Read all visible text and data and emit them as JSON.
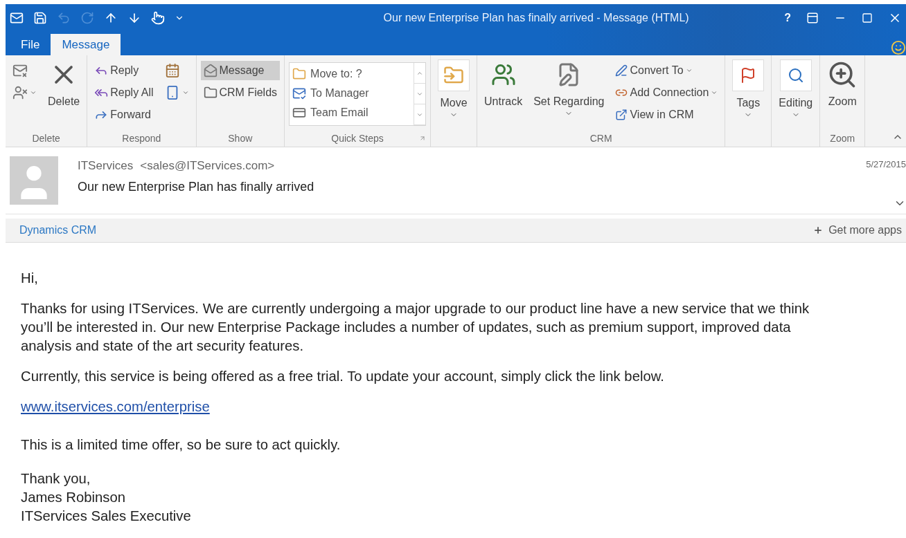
{
  "window": {
    "title": "Our new Enterprise Plan has finally arrived - Message (HTML)",
    "help": "?"
  },
  "quick_access": [
    {
      "disabled": false
    },
    {
      "disabled": false
    },
    {
      "disabled": true
    },
    {
      "disabled": true
    },
    {
      "disabled": false
    },
    {
      "disabled": false
    },
    {
      "disabled": false
    }
  ],
  "tabs": [
    {
      "label": "File",
      "selected": false
    },
    {
      "label": "Message",
      "selected": true
    }
  ],
  "ribbon": {
    "groups": [
      {
        "label": "Delete",
        "columns": [
          {
            "kind": "stack",
            "items": [
              {
                "dropdown": false
              },
              {
                "dropdown": true
              }
            ]
          },
          {
            "kind": "large",
            "items": [
              {
                "label": "Delete",
                "dropdown": false,
                "boxed": false
              }
            ]
          }
        ]
      },
      {
        "label": "Respond",
        "columns": [
          {
            "kind": "stack",
            "items": [
              {
                "label": "Reply",
                "dropdown": false,
                "selected": false
              },
              {
                "label": "Reply All",
                "dropdown": false,
                "selected": false
              },
              {
                "label": "Forward",
                "dropdown": false,
                "selected": false
              }
            ]
          },
          {
            "kind": "stack",
            "items": [
              {
                "dropdown": false
              },
              {
                "dropdown": true
              }
            ]
          }
        ]
      },
      {
        "label": "Show",
        "columns": [
          {
            "kind": "stack",
            "items": [
              {
                "label": "Message",
                "dropdown": false,
                "selected": true
              },
              {
                "label": "CRM Fields",
                "dropdown": false,
                "selected": false
              }
            ]
          }
        ]
      },
      {
        "label": "Quick Steps",
        "launcher": true,
        "columns": [
          {
            "kind": "gallery",
            "items": [
              {
                "label": "Move to: ?"
              },
              {
                "label": "To Manager"
              },
              {
                "label": "Team Email"
              }
            ]
          }
        ]
      },
      {
        "columns": [
          {
            "kind": "large",
            "items": [
              {
                "label": "Move",
                "dropdown": true,
                "boxed": true
              }
            ]
          }
        ]
      },
      {
        "label": "CRM",
        "columns": [
          {
            "kind": "large",
            "items": [
              {
                "label": "Untrack",
                "dropdown": false,
                "boxed": false
              }
            ]
          },
          {
            "kind": "large",
            "items": [
              {
                "label": "Set Regarding",
                "dropdown": true,
                "boxed": false
              }
            ]
          },
          {
            "kind": "stack",
            "items": [
              {
                "label": "Convert To",
                "dropdown": true,
                "selected": false
              },
              {
                "label": "Add Connection",
                "dropdown": true,
                "selected": false
              },
              {
                "label": "View in CRM",
                "dropdown": false,
                "selected": false
              }
            ]
          }
        ]
      },
      {
        "columns": [
          {
            "kind": "large",
            "items": [
              {
                "label": "Tags",
                "dropdown": true,
                "boxed": true
              }
            ]
          }
        ]
      },
      {
        "columns": [
          {
            "kind": "large",
            "items": [
              {
                "label": "Editing",
                "dropdown": true,
                "boxed": true
              }
            ]
          }
        ]
      },
      {
        "label": "Zoom",
        "columns": [
          {
            "kind": "large",
            "items": [
              {
                "label": "Zoom",
                "dropdown": false,
                "boxed": false
              }
            ]
          }
        ]
      }
    ]
  },
  "header": {
    "sender": "ITServices",
    "address": "<sales@ITServices.com>",
    "subject": "Our new Enterprise Plan has finally arrived",
    "date": "5/27/2015"
  },
  "apps_bar": {
    "app": "Dynamics CRM",
    "more": "Get more apps"
  },
  "body": [
    {
      "kind": "text",
      "text": "Hi,"
    },
    {
      "kind": "text",
      "text": "Thanks for using ITServices. We are currently undergoing a major upgrade to our product line have a new service that we think you’ll be interested in. Our new Enterprise Package includes a number of updates, such as premium support, improved data analysis and state of the art security features."
    },
    {
      "kind": "text",
      "text": "Currently, this service is being offered as a free trial. To update your account, simply click the link below."
    },
    {
      "kind": "link",
      "text": "www.itservices.com/enterprise"
    },
    {
      "kind": "text",
      "text": "This is a limited time offer, so be sure to act quickly."
    },
    {
      "kind": "lines",
      "lines": [
        "Thank you,",
        "James Robinson",
        "ITServices Sales Executive"
      ]
    }
  ]
}
